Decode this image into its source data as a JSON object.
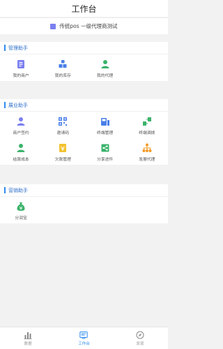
{
  "header": {
    "title": "工作台"
  },
  "org": {
    "name": "传统pos 一级代理商测试"
  },
  "sections": [
    {
      "title": "管理助手",
      "items": [
        {
          "label": "我的商户",
          "icon": "merchant-icon"
        },
        {
          "label": "我的库存",
          "icon": "inventory-icon"
        },
        {
          "label": "我的代理",
          "icon": "agent-icon"
        }
      ]
    },
    {
      "title": "展业助手",
      "items": [
        {
          "label": "商户签约",
          "icon": "merchant-sign-icon"
        },
        {
          "label": "邀请码",
          "icon": "invite-code-icon"
        },
        {
          "label": "终端管理",
          "icon": "terminal-manage-icon"
        },
        {
          "label": "终端调拨",
          "icon": "terminal-transfer-icon"
        },
        {
          "label": "结算成本",
          "icon": "settlement-cost-icon"
        },
        {
          "label": "欠款管理",
          "icon": "debt-manage-icon"
        },
        {
          "label": "分享进件",
          "icon": "share-apply-icon"
        },
        {
          "label": "发展代理",
          "icon": "develop-agent-icon"
        }
      ]
    },
    {
      "title": "营销助手",
      "items": [
        {
          "label": "分润宝",
          "icon": "profit-share-icon"
        }
      ]
    }
  ],
  "tabbar": [
    {
      "label": "数据",
      "icon": "data-chart-icon",
      "active": false
    },
    {
      "label": "工作台",
      "icon": "workbench-icon",
      "active": true
    },
    {
      "label": "发现",
      "icon": "discover-icon",
      "active": false
    }
  ],
  "colors": {
    "accent": "#2d8cf0",
    "purple": "#7b7ff0",
    "blue": "#4a7fe8",
    "green": "#3bb36b",
    "orange": "#f39a26"
  }
}
